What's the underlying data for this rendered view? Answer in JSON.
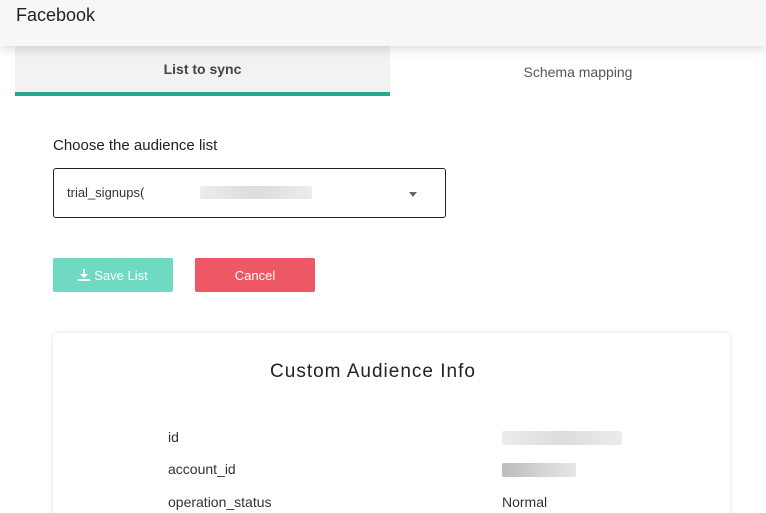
{
  "header": {
    "title": "Facebook"
  },
  "tabs": [
    {
      "label": "List to sync",
      "active": true
    },
    {
      "label": "Schema mapping",
      "active": false
    }
  ],
  "audience_select": {
    "label": "Choose the audience list",
    "value": "trial_signups("
  },
  "buttons": {
    "save_label": "Save List",
    "cancel_label": "Cancel"
  },
  "info_card": {
    "title": "Custom Audience Info",
    "rows": [
      {
        "key": "id",
        "value": ""
      },
      {
        "key": "account_id",
        "value": ""
      },
      {
        "key": "operation_status",
        "value": "Normal"
      }
    ]
  },
  "colors": {
    "accent": "#26a98f",
    "save_button": "#6fd9c1",
    "cancel_button": "#ee5766"
  },
  "icons": {
    "save": "download-icon",
    "select": "caret-down-icon"
  }
}
